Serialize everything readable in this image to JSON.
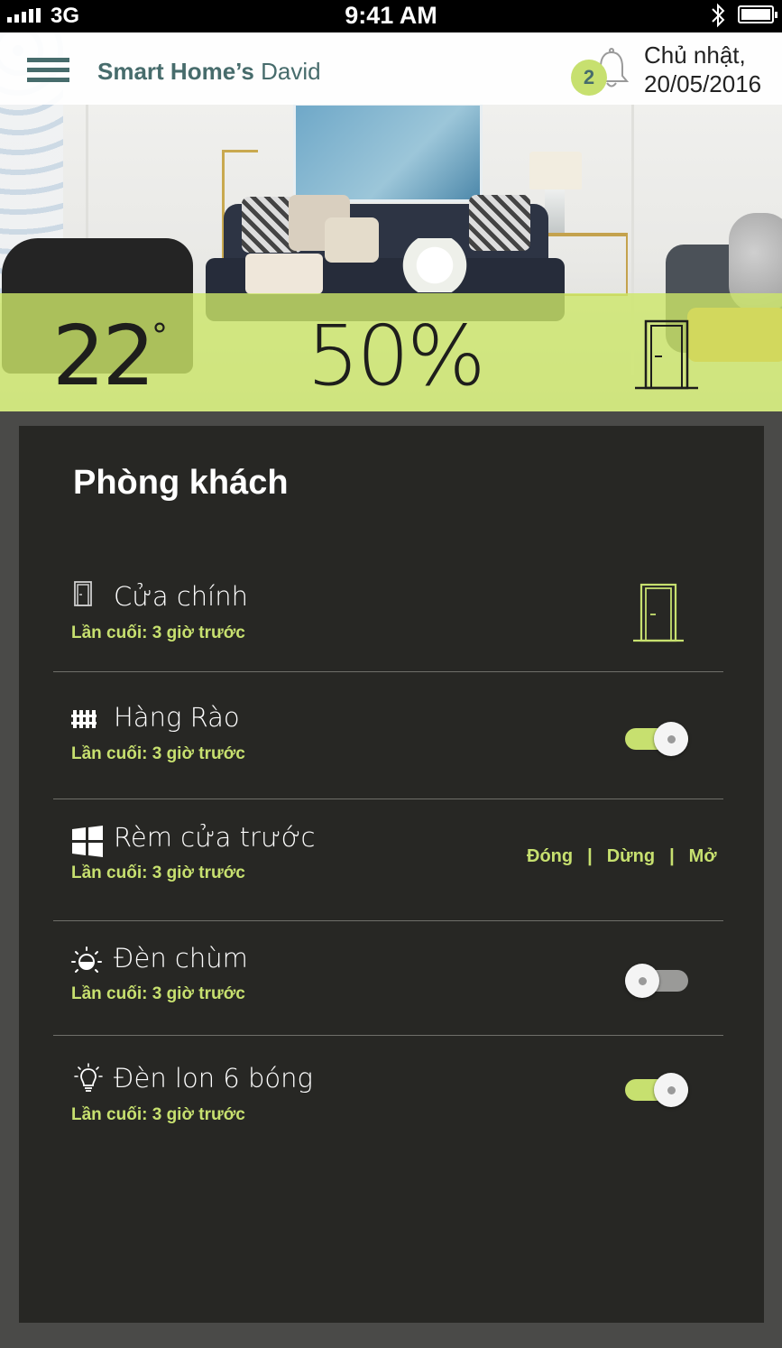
{
  "status_bar": {
    "carrier": "3G",
    "time": "9:41 AM"
  },
  "header": {
    "title_bold": "Smart Home’s",
    "title_user": "David",
    "notification_count": "2",
    "date_day": "Chủ nhật,",
    "date_value": "20/05/2016"
  },
  "stats": {
    "temperature": "22",
    "temperature_unit": "°",
    "humidity": "50%"
  },
  "room": {
    "title": "Phòng khách",
    "devices": [
      {
        "name": "Cửa chính",
        "last": "Lần cuối: 3 giờ trước",
        "icon": "door-icon",
        "control": "door"
      },
      {
        "name": "Hàng Rào",
        "last": "Lần cuối: 3 giờ trước",
        "icon": "fence-icon",
        "control": "toggle",
        "state": "on"
      },
      {
        "name": "Rèm cửa trước",
        "last": "Lần cuối: 3 giờ trước",
        "icon": "window-icon",
        "control": "curtain",
        "actions": [
          "Đóng",
          "Dừng",
          "Mở"
        ],
        "separator": "|"
      },
      {
        "name": "Đèn chùm",
        "last": "Lần cuối: 3 giờ trước",
        "icon": "chandelier-icon",
        "control": "toggle",
        "state": "off"
      },
      {
        "name": "Đèn lon 6 bóng",
        "last": "Lần cuối: 3 giờ trước",
        "icon": "bulb-icon",
        "control": "toggle",
        "state": "on"
      }
    ]
  },
  "colors": {
    "accent": "#c7e06f",
    "brand": "#476c6c",
    "panel": "#272724",
    "band": "#cde769"
  }
}
